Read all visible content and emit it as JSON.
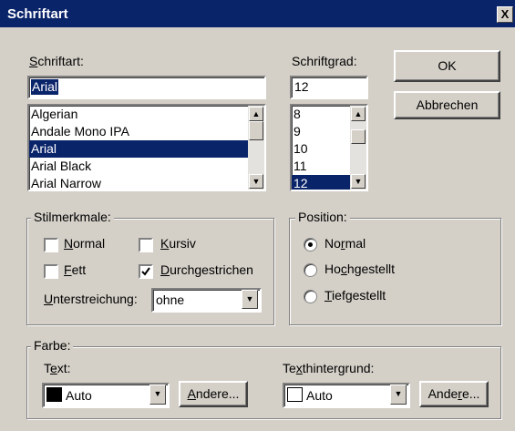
{
  "dialog": {
    "title": "Schriftart",
    "close_label": "X"
  },
  "font": {
    "label_u": "S",
    "label_rest": "chriftart:",
    "value": "Arial",
    "items": [
      "Algerian",
      "Andale Mono IPA",
      "Arial",
      "Arial Black",
      "Arial Narrow"
    ],
    "selected": "Arial"
  },
  "size": {
    "label": "Schriftgrad:",
    "value": "12",
    "items": [
      "8",
      "9",
      "10",
      "11",
      "12"
    ],
    "selected": "12"
  },
  "buttons": {
    "ok": "OK",
    "cancel": "Abbrechen"
  },
  "style": {
    "legend": "Stilmerkmale:",
    "normal_u": "N",
    "normal_rest": "ormal",
    "normal_checked": false,
    "bold_u": "F",
    "bold_rest": "ett",
    "bold_checked": false,
    "italic_u": "K",
    "italic_rest": "ursiv",
    "italic_checked": false,
    "strike_u": "D",
    "strike_rest": "urchgestrichen",
    "strike_checked": true,
    "underline_u": "U",
    "underline_rest": "nterstreichung:",
    "underline_value": "ohne"
  },
  "position": {
    "legend": "Position:",
    "normal_a": "No",
    "normal_u": "r",
    "normal_b": "mal",
    "superscript_a": "Ho",
    "superscript_u": "c",
    "superscript_b": "hgestellt",
    "subscript_u": "T",
    "subscript_b": "iefgestellt",
    "selected": "Normal"
  },
  "color": {
    "legend": "Farbe:",
    "text_a": "T",
    "text_u": "e",
    "text_b": "xt:",
    "text_value": "Auto",
    "text_swatch": "#000000",
    "text_other_u": "A",
    "text_other_b": "ndere...",
    "bg_a": "Te",
    "bg_u": "x",
    "bg_b": "thintergrund:",
    "bg_value": "Auto",
    "bg_swatch": "#ffffff",
    "bg_other_a": "Ande",
    "bg_other_u": "r",
    "bg_other_b": "e..."
  }
}
